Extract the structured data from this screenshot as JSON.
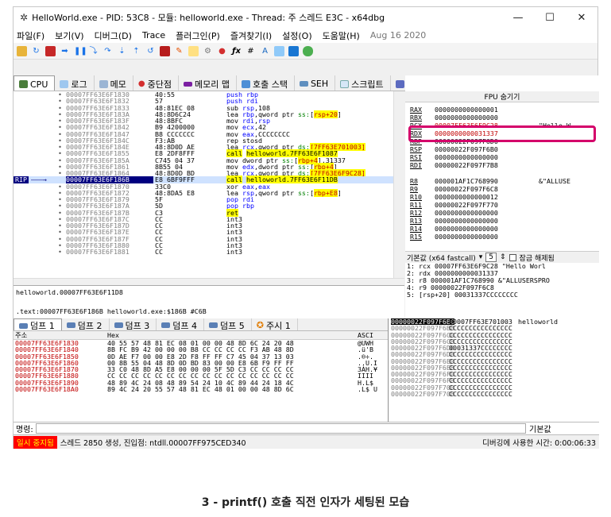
{
  "window": {
    "title": "HelloWorld.exe - PID: 53C8 - 모듈: helloworld.exe - Thread: 주 스레드 E3C - x64dbg",
    "minimize": "—",
    "maximize": "☐",
    "close": "✕"
  },
  "menu": {
    "items": [
      "파일(F)",
      "보기(V)",
      "디버그(D)",
      "Trace",
      "플러그인(P)",
      "즐겨찾기(I)",
      "설정(O)",
      "도움말(H)"
    ],
    "date": "Aug 16 2020"
  },
  "tabs": [
    "CPU",
    "로그",
    "메모",
    "중단점",
    "메모리 맵",
    "호출 스택",
    "SEH",
    "스크립트",
    "기호",
    "소스",
    "참"
  ],
  "disasm": {
    "rows": [
      {
        "addr": "00007FF63E6F1830",
        "bytes": "40:55",
        "instr": [
          [
            "push ",
            "kw"
          ],
          [
            "rbp",
            "kw"
          ]
        ]
      },
      {
        "addr": "00007FF63E6F1832",
        "bytes": "57",
        "instr": [
          [
            "push ",
            "kw"
          ],
          [
            "rdi",
            "kw"
          ]
        ]
      },
      {
        "addr": "00007FF63E6F1833",
        "bytes": "48:81EC 08",
        "instr": [
          [
            "sub ",
            ""
          ],
          [
            "rsp",
            "kw"
          ],
          [
            ",108",
            ""
          ]
        ]
      },
      {
        "addr": "00007FF63E6F183A",
        "bytes": "48:8D6C24",
        "instr": [
          [
            "lea ",
            ""
          ],
          [
            "rbp",
            "kw"
          ],
          [
            ",qword ptr ",
            ""
          ],
          [
            "ss:",
            "ptr"
          ],
          [
            "[",
            ""
          ],
          [
            "rsp+20",
            "hlmem"
          ],
          [
            "]",
            ""
          ]
        ]
      },
      {
        "addr": "00007FF63E6F183F",
        "bytes": "48:8BFC",
        "instr": [
          [
            "mov ",
            ""
          ],
          [
            "rdi",
            "kw"
          ],
          [
            ",",
            ""
          ],
          [
            "rsp",
            "kw"
          ]
        ]
      },
      {
        "addr": "00007FF63E6F1842",
        "bytes": "B9 4200000",
        "instr": [
          [
            "mov ",
            ""
          ],
          [
            "ecx",
            "kw"
          ],
          [
            ",42",
            ""
          ]
        ]
      },
      {
        "addr": "00007FF63E6F1847",
        "bytes": "B8 CCCCCCC",
        "instr": [
          [
            "mov ",
            ""
          ],
          [
            "eax",
            "kw"
          ],
          [
            ",CCCCCCCC",
            ""
          ]
        ]
      },
      {
        "addr": "00007FF63E6F184C",
        "bytes": "F3:AB",
        "instr": [
          [
            "rep stosd",
            ""
          ]
        ]
      },
      {
        "addr": "00007FF63E6F184E",
        "bytes": "48:8D0D AE",
        "instr": [
          [
            "lea ",
            ""
          ],
          [
            "rcx",
            "kw"
          ],
          [
            ",qword ptr ",
            ""
          ],
          [
            "ds:",
            "ptr"
          ],
          [
            "[7FF63E701003]",
            "hlmem"
          ]
        ]
      },
      {
        "addr": "00007FF63E6F1855",
        "bytes": "E8 2DF8FFF",
        "instr": [
          [
            "call",
            "hlcall"
          ],
          [
            " ",
            ""
          ],
          [
            "helloworld.7FF63E6F1087",
            "hlcall"
          ]
        ]
      },
      {
        "addr": "00007FF63E6F185A",
        "bytes": "C745 04 37",
        "instr": [
          [
            "mov ",
            ""
          ],
          [
            "dword ptr ",
            ""
          ],
          [
            "ss:",
            "ptr"
          ],
          [
            "[",
            ""
          ],
          [
            "rbp+4",
            "hlmem"
          ],
          [
            "],31337",
            ""
          ]
        ]
      },
      {
        "addr": "00007FF63E6F1861",
        "bytes": "8B55 04",
        "instr": [
          [
            "mov ",
            ""
          ],
          [
            "edx",
            "kw"
          ],
          [
            ",dword ptr ",
            ""
          ],
          [
            "ss:",
            "ptr"
          ],
          [
            "[",
            ""
          ],
          [
            "rbp+4",
            "hlmem"
          ],
          [
            "]",
            ""
          ]
        ]
      },
      {
        "addr": "00007FF63E6F1864",
        "bytes": "48:8D0D BD",
        "instr": [
          [
            "lea ",
            ""
          ],
          [
            "rcx",
            "kw"
          ],
          [
            ",qword ptr ",
            ""
          ],
          [
            "ds:",
            "ptr"
          ],
          [
            "[7FF63E6F9C28]",
            "hlmem"
          ]
        ]
      },
      {
        "addr": "00007FF63E6F186B",
        "bytes": "E8 6BF9FFF",
        "instr": [
          [
            "call",
            "hlcall"
          ],
          [
            " ",
            ""
          ],
          [
            "helloworld.7FF63E6F11DB",
            "hlcall"
          ]
        ],
        "rip": true
      },
      {
        "addr": "00007FF63E6F1870",
        "bytes": "33C0",
        "instr": [
          [
            "xor ",
            ""
          ],
          [
            "eax",
            "kw"
          ],
          [
            ",",
            ""
          ],
          [
            "eax",
            "kw"
          ]
        ]
      },
      {
        "addr": "00007FF63E6F1872",
        "bytes": "48:8DA5 E8",
        "instr": [
          [
            "lea ",
            ""
          ],
          [
            "rsp",
            "kw"
          ],
          [
            ",qword ptr ",
            ""
          ],
          [
            "ss:",
            "ptr"
          ],
          [
            "[",
            ""
          ],
          [
            "rbp+E8",
            "hlmem"
          ],
          [
            "]",
            ""
          ]
        ]
      },
      {
        "addr": "00007FF63E6F1879",
        "bytes": "5F",
        "instr": [
          [
            "pop ",
            "kw"
          ],
          [
            "rdi",
            "kw"
          ]
        ]
      },
      {
        "addr": "00007FF63E6F187A",
        "bytes": "5D",
        "instr": [
          [
            "pop ",
            "kw"
          ],
          [
            "rbp",
            "kw"
          ]
        ]
      },
      {
        "addr": "00007FF63E6F187B",
        "bytes": "C3",
        "instr": [
          [
            "ret",
            "hlcall"
          ]
        ]
      },
      {
        "addr": "00007FF63E6F187C",
        "bytes": "CC",
        "instr": [
          [
            "int3",
            ""
          ]
        ]
      },
      {
        "addr": "00007FF63E6F187D",
        "bytes": "CC",
        "instr": [
          [
            "int3",
            ""
          ]
        ]
      },
      {
        "addr": "00007FF63E6F187E",
        "bytes": "CC",
        "instr": [
          [
            "int3",
            ""
          ]
        ]
      },
      {
        "addr": "00007FF63E6F187F",
        "bytes": "CC",
        "instr": [
          [
            "int3",
            ""
          ]
        ]
      },
      {
        "addr": "00007FF63E6F1880",
        "bytes": "CC",
        "instr": [
          [
            "int3",
            ""
          ]
        ]
      },
      {
        "addr": "00007FF63E6F1881",
        "bytes": "CC",
        "instr": [
          [
            "int3",
            ""
          ]
        ]
      }
    ],
    "rip_label": "RIP"
  },
  "info": {
    "line1": "helloworld.00007FF63E6F11D8",
    "line2": ".text:00007FF63E6F186B helloworld.exe:$186B #C6B"
  },
  "registers": {
    "title": "FPU 숨기기",
    "rows": [
      {
        "name": "RAX",
        "val": "0000000000000001",
        "str": ""
      },
      {
        "name": "RBX",
        "val": "0000000000000000",
        "str": ""
      },
      {
        "name": "RCX",
        "val": "00007FF63E6F9C28",
        "str": "\"Hello W",
        "changed": true
      },
      {
        "name": "RDX",
        "val": "0000000000031337",
        "str": "",
        "changed": true
      },
      {
        "name": "RBP",
        "val": "00000022F097F6D0",
        "str": ""
      },
      {
        "name": "RSP",
        "val": "00000022F097F6B0",
        "str": ""
      },
      {
        "name": "RSI",
        "val": "0000000000000000",
        "str": ""
      },
      {
        "name": "RDI",
        "val": "00000022F097F7B8",
        "str": ""
      },
      {
        "name": "",
        "val": "",
        "str": ""
      },
      {
        "name": "R8",
        "val": "000001AF1C768990",
        "str": "&\"ALLUSE"
      },
      {
        "name": "R9",
        "val": "00000022F097F6C8",
        "str": ""
      },
      {
        "name": "R10",
        "val": "0000000000000012",
        "str": ""
      },
      {
        "name": "R11",
        "val": "00000022F097F770",
        "str": ""
      },
      {
        "name": "R12",
        "val": "0000000000000000",
        "str": ""
      },
      {
        "name": "R13",
        "val": "0000000000000000",
        "str": ""
      },
      {
        "name": "R14",
        "val": "0000000000000000",
        "str": ""
      },
      {
        "name": "R15",
        "val": "0000000000000000",
        "str": ""
      }
    ],
    "callconv": "기본값 (x64 fastcall)",
    "argcount": "5",
    "lock_label": "잠금 해제됨",
    "args": [
      "1: rcx 00007FF63E6F9C28 \"Hello Worl",
      "2: rdx 0000000000031337",
      "3: r8 000001AF1C768990 &\"ALLUSERSPRO",
      "4: r9 00000022F097F6C8",
      "5: [rsp+20] 00031337CCCCCCCC"
    ]
  },
  "dump": {
    "tabs": [
      "덤프 1",
      "덤프 2",
      "덤프 3",
      "덤프 4",
      "덤프 5",
      "주시 1"
    ],
    "hdr_addr": "주소",
    "hdr_hex": "Hex",
    "hdr_ascii": "ASCI",
    "rows": [
      {
        "addr": "00007FF63E6F1830",
        "hex": "40 55 57 48 81 EC 08 01 00 00 48 8D 6C 24 20 48",
        "asc": "@UWH"
      },
      {
        "addr": "00007FF63E6F1840",
        "hex": "8B FC B9 42 00 00 00 B8 CC CC CC CC F3 AB 48 8D",
        "asc": ".ü'B"
      },
      {
        "addr": "00007FF63E6F1850",
        "hex": "0D AE F7 00 00 E8 2D F8 FF FF C7 45 04 37 13 03",
        "asc": ".®÷."
      },
      {
        "addr": "00007FF63E6F1860",
        "hex": "00 8B 55 04 48 8D 0D BD 83 00 00 E8 6B F9 FF FF",
        "asc": "..U.I"
      },
      {
        "addr": "00007FF63E6F1870",
        "hex": "33 C0 48 8D A5 E8 00 00 00 5F 5D C3 CC CC CC CC",
        "asc": "3ÀH.¥"
      },
      {
        "addr": "00007FF63E6F1880",
        "hex": "CC CC CC CC CC CC CC CC CC CC CC CC CC CC CC CC",
        "asc": "IIII"
      },
      {
        "addr": "00007FF63E6F1890",
        "hex": "48 89 4C 24 08 48 89 54 24 10 4C 89 44 24 18 4C",
        "asc": "H.L$"
      },
      {
        "addr": "00007FF63E6F18A0",
        "hex": "89 4C 24 20 55 57 48 81 EC 48 01 00 00 48 8D 6C",
        "asc": ".L$ U"
      }
    ]
  },
  "stack": {
    "rows": [
      {
        "addr": "00000022F097F6B0",
        "val": "00007FF63E701003",
        "cmt": "helloworld",
        "sel": true
      },
      {
        "addr": "00000022F097F6B8",
        "val": "CCCCCCCCCCCCCCCC",
        "cmt": ""
      },
      {
        "addr": "00000022F097F6C0",
        "val": "CCCCCCCCCCCCCCCC",
        "cmt": ""
      },
      {
        "addr": "00000022F097F6C8",
        "val": "CCCCCCCCCCCCCCCC",
        "cmt": ""
      },
      {
        "addr": "00000022F097F6D0",
        "val": "00031337CCCCCCCC",
        "cmt": ""
      },
      {
        "addr": "00000022F097F6D8",
        "val": "CCCCCCCCCCCCCCCC",
        "cmt": ""
      },
      {
        "addr": "00000022F097F6E0",
        "val": "CCCCCCCCCCCCCCCC",
        "cmt": ""
      },
      {
        "addr": "00000022F097F6E8",
        "val": "CCCCCCCCCCCCCCCC",
        "cmt": ""
      },
      {
        "addr": "00000022F097F6F0",
        "val": "CCCCCCCCCCCCCCCC",
        "cmt": ""
      },
      {
        "addr": "00000022F097F6F8",
        "val": "CCCCCCCCCCCCCCCC",
        "cmt": ""
      },
      {
        "addr": "00000022F097F700",
        "val": "CCCCCCCCCCCCCCCC",
        "cmt": ""
      },
      {
        "addr": "00000022F097F708",
        "val": "CCCCCCCCCCCCCCCC",
        "cmt": ""
      }
    ]
  },
  "command": {
    "label": "명령:",
    "default": "기본값"
  },
  "status": {
    "paused": "일시 중지됨",
    "message": "스레드 2850 생성, 진입점: ntdll.00007FF975CED340",
    "timer": "디버깅에 사용한 시간: 0:00:06:33"
  },
  "caption": "3 - printf() 호출 직전 인자가 세팅된 모습",
  "colors": {
    "highlight_border": "#d4006a",
    "paused_bg": "#ff0000",
    "call_highlight": "#ffff00"
  }
}
